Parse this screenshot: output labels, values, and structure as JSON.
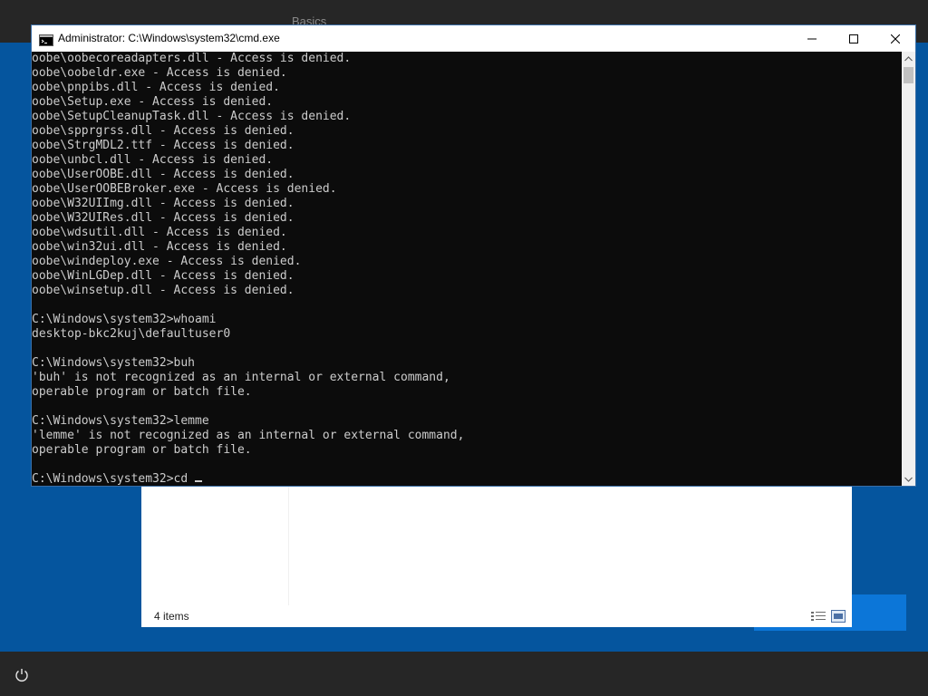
{
  "background": {
    "title": "Basics",
    "colors": {
      "blue": "#05559e",
      "dark": "#262626",
      "button_blue": "#0c76d8"
    }
  },
  "explorer": {
    "status_text": "4 items",
    "view_icons": [
      "details-view-icon",
      "large-icons-view-icon"
    ]
  },
  "cmd": {
    "title": "Administrator: C:\\Windows\\system32\\cmd.exe",
    "controls": {
      "minimize": "minimize-icon",
      "maximize": "maximize-icon",
      "close": "close-icon"
    },
    "lines": [
      "oobe\\oobecoreadapters.dll - Access is denied.",
      "oobe\\oobeldr.exe - Access is denied.",
      "oobe\\pnpibs.dll - Access is denied.",
      "oobe\\Setup.exe - Access is denied.",
      "oobe\\SetupCleanupTask.dll - Access is denied.",
      "oobe\\spprgrss.dll - Access is denied.",
      "oobe\\StrgMDL2.ttf - Access is denied.",
      "oobe\\unbcl.dll - Access is denied.",
      "oobe\\UserOOBE.dll - Access is denied.",
      "oobe\\UserOOBEBroker.exe - Access is denied.",
      "oobe\\W32UIImg.dll - Access is denied.",
      "oobe\\W32UIRes.dll - Access is denied.",
      "oobe\\wdsutil.dll - Access is denied.",
      "oobe\\win32ui.dll - Access is denied.",
      "oobe\\windeploy.exe - Access is denied.",
      "oobe\\WinLGDep.dll - Access is denied.",
      "oobe\\winsetup.dll - Access is denied.",
      "",
      "C:\\Windows\\system32>whoami",
      "desktop-bkc2kuj\\defaultuser0",
      "",
      "C:\\Windows\\system32>buh",
      "'buh' is not recognized as an internal or external command,",
      "operable program or batch file.",
      "",
      "C:\\Windows\\system32>lemme",
      "'lemme' is not recognized as an internal or external command,",
      "operable program or batch file.",
      "",
      "C:\\Windows\\system32>cd"
    ],
    "colors": {
      "console_bg": "#0c0c0c",
      "console_fg": "#cccccc"
    }
  },
  "taskbar": {
    "power_icon": "power-icon"
  }
}
